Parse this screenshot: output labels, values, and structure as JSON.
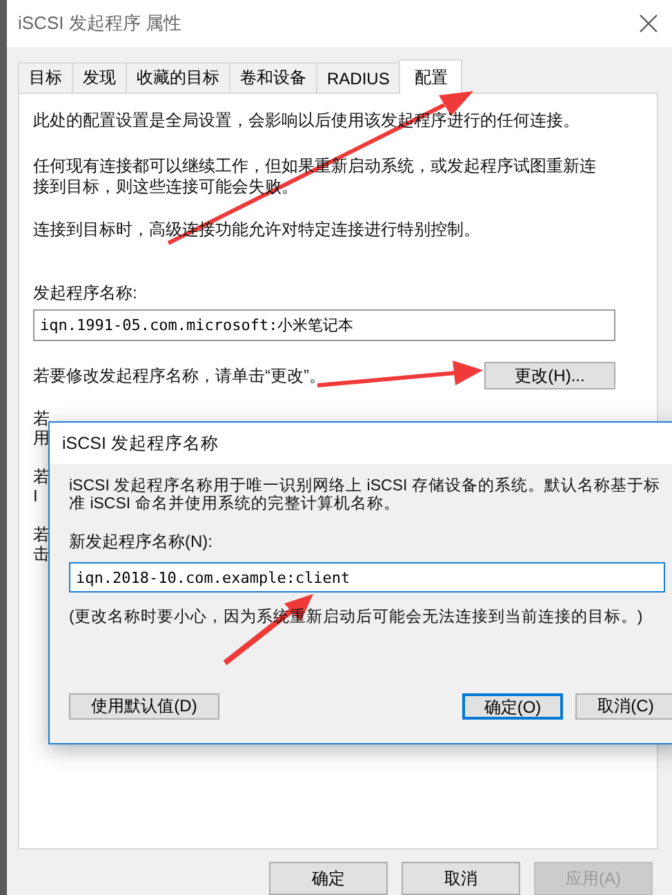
{
  "window": {
    "title": "iSCSI 发起程序 属性"
  },
  "tabs": [
    {
      "label": "目标",
      "selected": false
    },
    {
      "label": "发现",
      "selected": false
    },
    {
      "label": "收藏的目标",
      "selected": false
    },
    {
      "label": "卷和设备",
      "selected": false
    },
    {
      "label": "RADIUS",
      "selected": false
    },
    {
      "label": "配置",
      "selected": true
    }
  ],
  "panel": {
    "paragraphs": [
      "此处的配置设置是全局设置，会影响以后使用该发起程序进行的任何连接。",
      "任何现有连接都可以继续工作，但如果重新启动系统，或发起程序试图重新连接到目标，则这些连接可能会失败。",
      "连接到目标时，高级连接功能允许对特定连接进行特别控制。"
    ],
    "name_label": "发起程序名称:",
    "name_value": "iqn.1991-05.com.microsoft:小米笔记本",
    "change_hint": "若要修改发起程序名称，请单击“更改”。",
    "change_button": "更改(H)...",
    "hidden_fragments": [
      [
        "若",
        "用"
      ],
      [
        "若",
        "I"
      ],
      [
        "若",
        "击"
      ]
    ]
  },
  "dialog": {
    "title": "iSCSI 发起程序名称",
    "description": "iSCSI 发起程序名称用于唯一识别网络上 iSCSI 存储设备的系统。默认名称基于标准 iSCSI 命名并使用系统的完整计算机名称。",
    "field_label": "新发起程序名称(N):",
    "field_value": "iqn.2018-10.com.example:client",
    "warning": "(更改名称时要小心，因为系统重新启动后可能会无法连接到当前连接的目标。)",
    "buttons": [
      {
        "label": "使用默认值(D)",
        "focused": false
      },
      {
        "label": "确定(O)",
        "focused": true
      },
      {
        "label": "取消(C)",
        "focused": false
      }
    ]
  },
  "buttons": [
    {
      "label": "确定",
      "disabled": false
    },
    {
      "label": "取消",
      "disabled": false
    },
    {
      "label": "应用(A)",
      "disabled": true
    }
  ]
}
